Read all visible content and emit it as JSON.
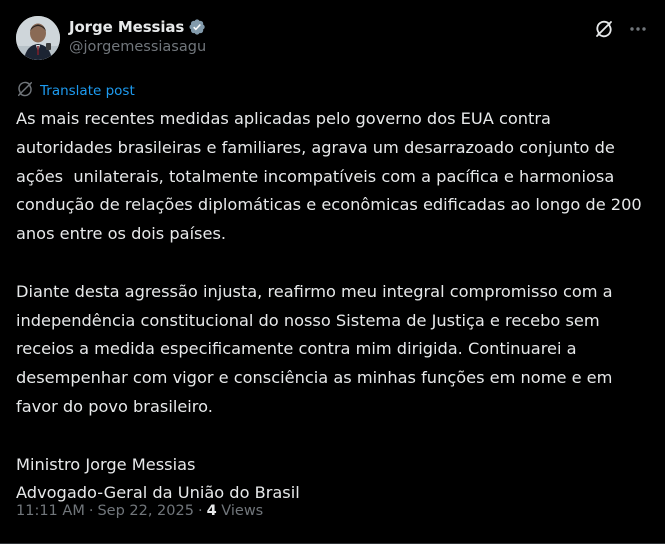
{
  "post": {
    "author": {
      "display_name": "Jorge Messias",
      "handle": "@jorgemessiasagu",
      "verified": true
    },
    "translate_label": "Translate post",
    "paragraphs": [
      "As mais recentes medidas aplicadas pelo governo dos EUA contra autoridades brasileiras e familiares, agrava um desarrazoado conjunto de ações  unilaterais, totalmente incompatíveis com a pacífica e harmoniosa condução de relações diplomáticas e econômicas edificadas ao longo de 200 anos entre os dois países.",
      "Diante desta agressão injusta, reafirmo meu integral compromisso com a independência constitucional do nosso Sistema de Justiça e recebo sem receios a medida especificamente contra mim dirigida. Continuarei a desempenhar com vigor e consciência as minhas funções em nome e em favor do povo brasileiro.",
      "Ministro Jorge Messias\nAdvogado-Geral da União do Brasil"
    ],
    "meta": {
      "time": "11:11 AM",
      "date": "Sep 22, 2025",
      "views_count": "4",
      "views_label": "Views"
    }
  },
  "icons": {
    "verified": "verified-badge-icon",
    "grok": "grok-icon",
    "more": "more-options-icon",
    "translate": "translate-icon"
  },
  "colors": {
    "background": "#000000",
    "text_primary": "#e7e9ea",
    "text_secondary": "#71767b",
    "link": "#1d9bf0",
    "verified_badge": "#829aab"
  }
}
